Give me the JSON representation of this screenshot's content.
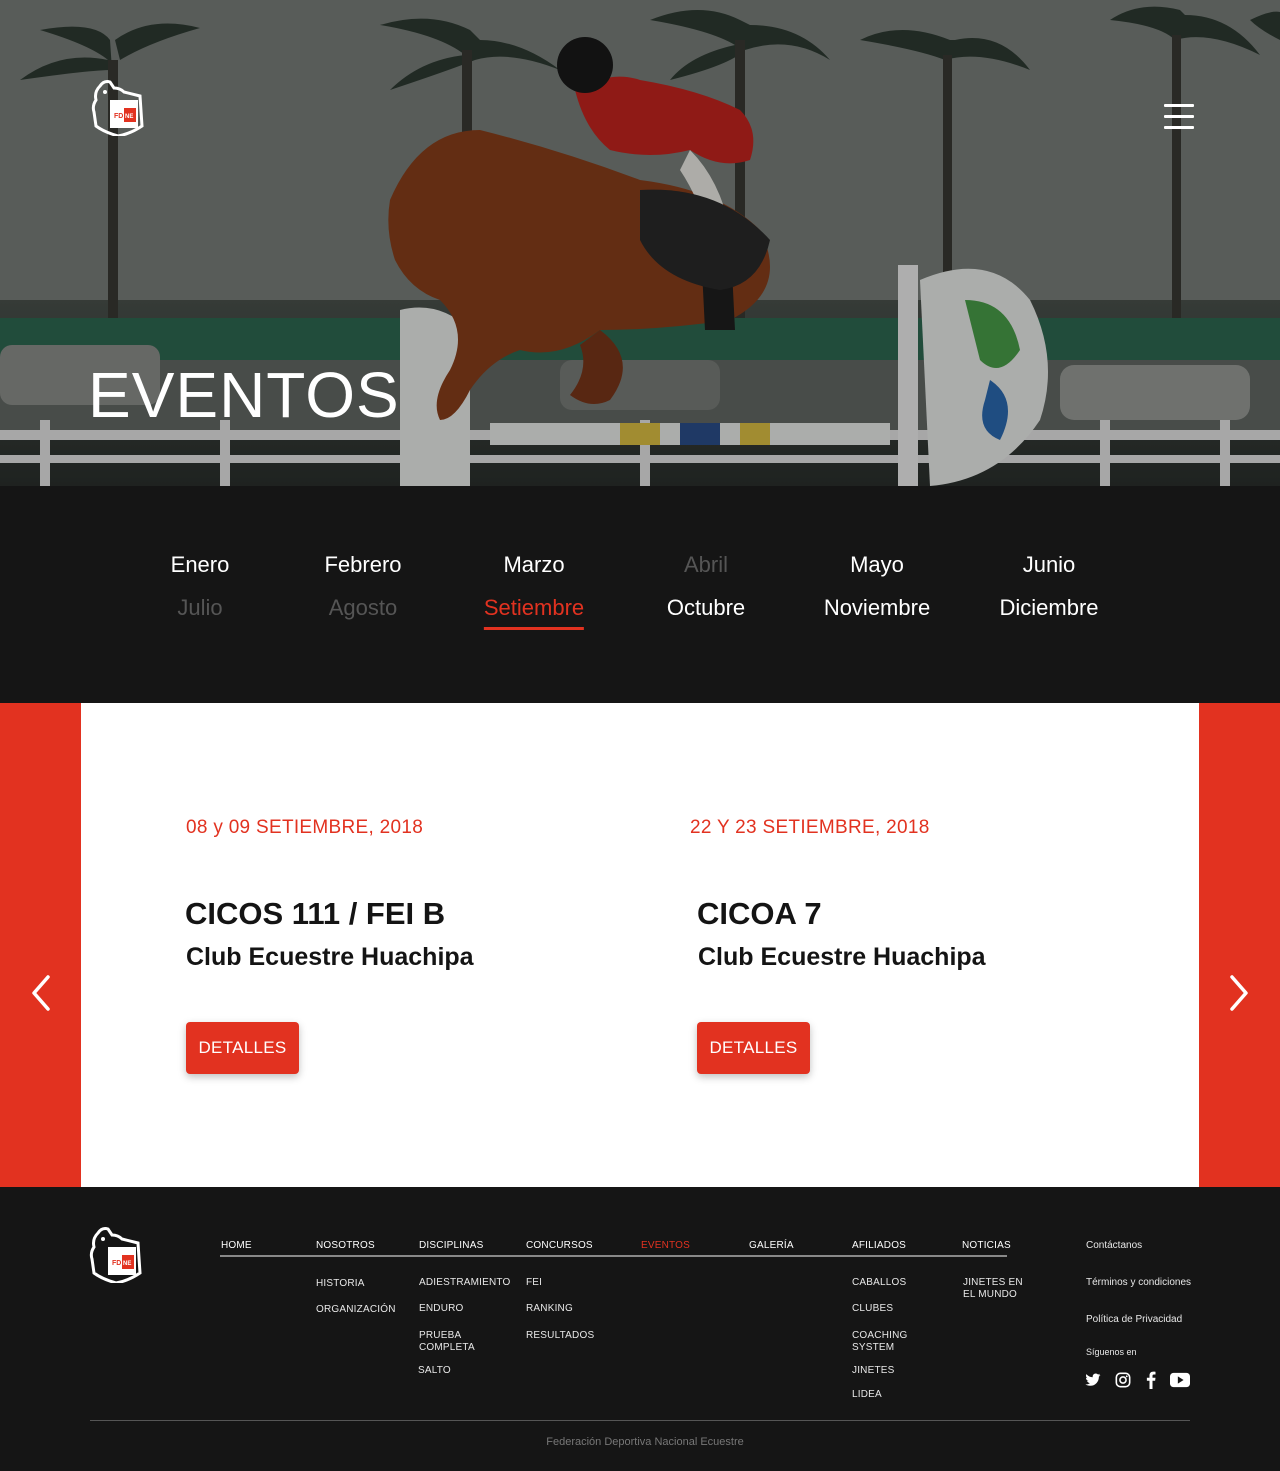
{
  "hero": {
    "title": "EVENTOS",
    "logo_text": "FDNE"
  },
  "months": [
    {
      "label": "Enero",
      "state": "on"
    },
    {
      "label": "Febrero",
      "state": "on"
    },
    {
      "label": "Marzo",
      "state": "on"
    },
    {
      "label": "Abril",
      "state": "dim"
    },
    {
      "label": "Mayo",
      "state": "on"
    },
    {
      "label": "Junio",
      "state": "on"
    },
    {
      "label": "Julio",
      "state": "dim"
    },
    {
      "label": "Agosto",
      "state": "dim"
    },
    {
      "label": "Setiembre",
      "state": "active"
    },
    {
      "label": "Octubre",
      "state": "on"
    },
    {
      "label": "Noviembre",
      "state": "on"
    },
    {
      "label": "Diciembre",
      "state": "on"
    }
  ],
  "events": [
    {
      "date": "08 y 09 SETIEMBRE, 2018",
      "title": "CICOS 111 / FEI B",
      "venue": "Club Ecuestre Huachipa",
      "button": "DETALLES"
    },
    {
      "date": "22 Y 23 SETIEMBRE, 2018",
      "title": "CICOA 7",
      "venue": "Club Ecuestre Huachipa",
      "button": "DETALLES"
    }
  ],
  "footer": {
    "nav": [
      "HOME",
      "NOSOTROS",
      "DISCIPLINAS",
      "CONCURSOS",
      "EVENTOS",
      "GALERÍA",
      "AFILIADOS",
      "NOTICIAS"
    ],
    "active_nav": "EVENTOS",
    "nosotros_sub": [
      "HISTORIA",
      "ORGANIZACIÓN"
    ],
    "disciplinas_sub": [
      "ADIESTRAMIENTO",
      "ENDURO",
      "PRUEBA COMPLETA",
      "SALTO"
    ],
    "concursos_sub": [
      "FEI",
      "RANKING",
      "RESULTADOS"
    ],
    "afiliados_sub": [
      "CABALLOS",
      "CLUBES",
      "COACHING SYSTEM",
      "JINETES",
      "LIDEA"
    ],
    "noticias_sub": [
      "JINETES EN EL MUNDO"
    ],
    "right_links": [
      "Contáctanos",
      "Términos y condiciones",
      "Política de Privacidad"
    ],
    "social_label": "Síguenos en",
    "social_icons": [
      "twitter-icon",
      "instagram-icon",
      "facebook-icon",
      "youtube-icon"
    ],
    "copyright": "Federación Deportiva Nacional Ecuestre"
  },
  "colors": {
    "accent": "#e23220",
    "dark": "#151515",
    "dim_month": "#555555"
  }
}
